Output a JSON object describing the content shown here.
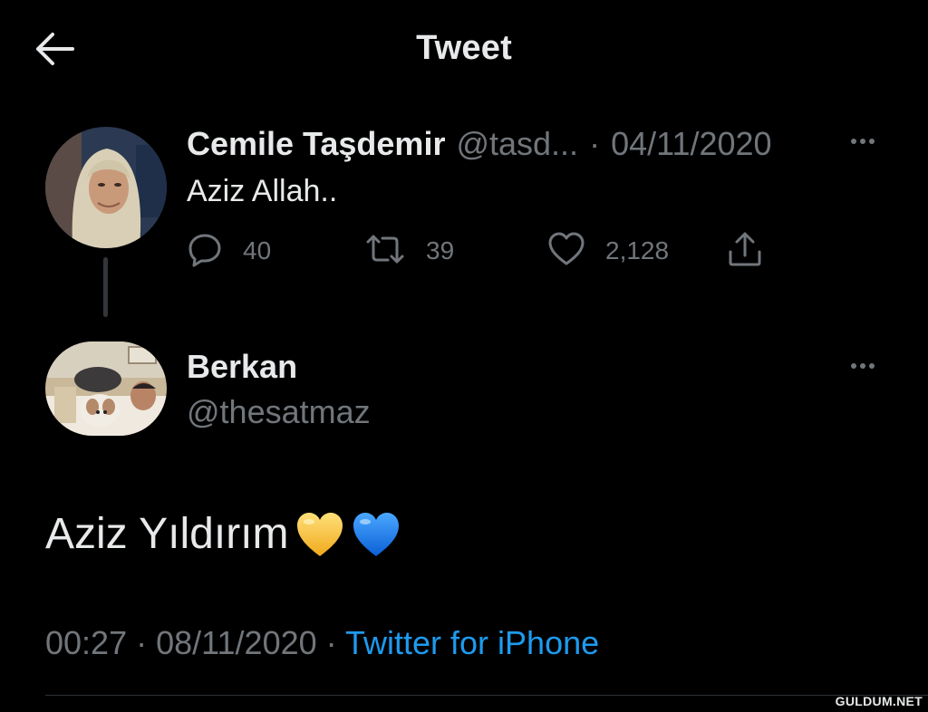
{
  "header": {
    "title": "Tweet",
    "back_icon": "arrow-left-icon"
  },
  "parent_tweet": {
    "display_name": "Cemile Taşdemir",
    "handle": "@tasd...",
    "separator": "·",
    "date": "04/11/2020",
    "text": "Aziz Allah..",
    "stats": {
      "replies": "40",
      "retweets": "39",
      "likes": "2,128"
    }
  },
  "reply_tweet": {
    "display_name": "Berkan",
    "handle": "@thesatmaz",
    "text": "Aziz Yıldırım",
    "emojis": [
      "yellow-heart-emoji",
      "blue-heart-emoji"
    ],
    "time": "00:27",
    "separator": "·",
    "date": "08/11/2020",
    "source": "Twitter for iPhone"
  },
  "watermark": "GULDUM.NET",
  "colors": {
    "background": "#000000",
    "text_primary": "#e7e9ea",
    "text_secondary": "#71767b",
    "link": "#1d9bf0",
    "yellow_heart": "#f5c242",
    "blue_heart": "#1e82f0"
  }
}
